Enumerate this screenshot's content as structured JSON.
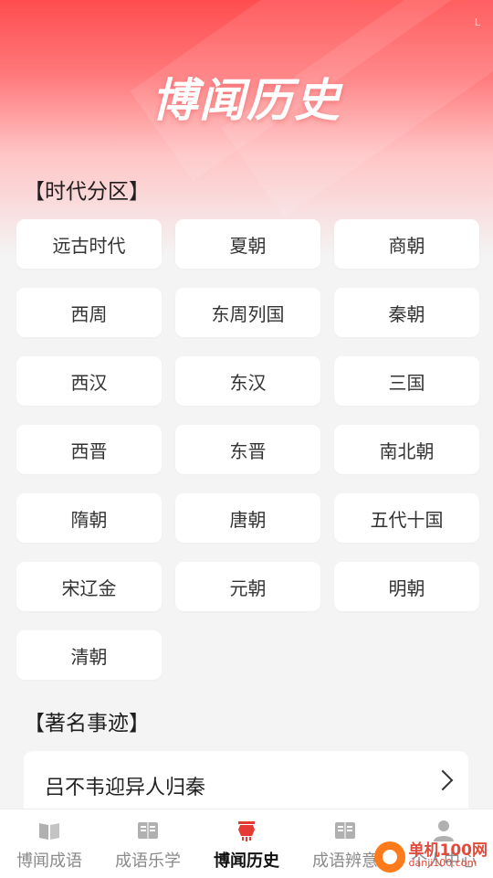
{
  "header": {
    "title": "博闻历史",
    "status_mark": "L"
  },
  "eras_section": {
    "title": "【时代分区】",
    "items": [
      "远古时代",
      "夏朝",
      "商朝",
      "西周",
      "东周列国",
      "秦朝",
      "西汉",
      "东汉",
      "三国",
      "西晋",
      "东晋",
      "南北朝",
      "隋朝",
      "唐朝",
      "五代十国",
      "宋辽金",
      "元朝",
      "明朝",
      "清朝"
    ]
  },
  "events_section": {
    "title": "【著名事迹】",
    "first_story": "吕不韦迎异人归秦"
  },
  "bottom_nav": {
    "items": [
      {
        "label": "博闻成语",
        "icon": "open-book-icon"
      },
      {
        "label": "成语乐学",
        "icon": "book-icon"
      },
      {
        "label": "博闻历史",
        "icon": "lantern-icon"
      },
      {
        "label": "成语辨意",
        "icon": "book-icon"
      },
      {
        "label": "个人中心",
        "icon": "person-icon"
      }
    ],
    "active_index": 2
  },
  "watermark": {
    "main": "单机100网",
    "sub": "danji100.com"
  },
  "colors": {
    "accent": "#ff4d4f",
    "nav_active": "#e53935",
    "nav_inactive": "#b0b0b0"
  }
}
